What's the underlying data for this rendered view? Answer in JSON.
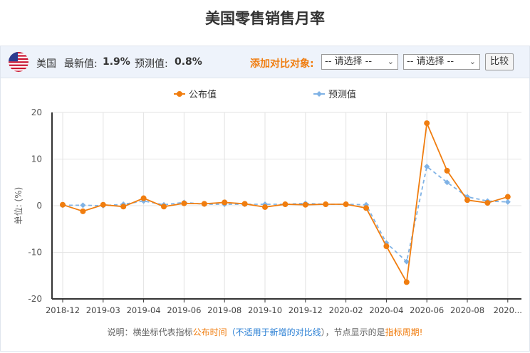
{
  "page": {
    "title": "美国零售销售月率"
  },
  "toolbar": {
    "country": "美国",
    "latest_label": "最新值:",
    "latest_value": "1.9%",
    "forecast_label": "预测值:",
    "forecast_value": "0.8%",
    "compare_label": "添加对比对象:",
    "select1": "-- 请选择 --",
    "select2": "-- 请选择 --",
    "compare_button": "比较"
  },
  "note": {
    "p1": "说明：横坐标代表指标",
    "p2": "公布时间",
    "p3": "（",
    "p4": "不适用于新增的对比线",
    "p5": "），节点显示的是",
    "p6": "指标周期!"
  },
  "colors": {
    "actual": "#f07d0f",
    "forecast": "#7fb2e5",
    "accent": "#f07d0f"
  },
  "chart_data": {
    "type": "line",
    "ylabel": "单位: (%)",
    "ylim": [
      -20,
      20
    ],
    "yticks": [
      20,
      10,
      0,
      -10,
      -20
    ],
    "xtick_labels": [
      "2018-12",
      "2019-03",
      "2019-04",
      "2019-06",
      "2019-08",
      "2019-10",
      "2019-12",
      "2020-02",
      "2020-04",
      "2020-06",
      "2020-08",
      "2020..."
    ],
    "legend": {
      "position": "top",
      "items": [
        "公布值",
        "预测值"
      ]
    },
    "series": [
      {
        "name": "公布值",
        "style": "solid",
        "values": [
          0.2,
          -1.2,
          0.2,
          -0.2,
          1.6,
          -0.2,
          0.5,
          0.4,
          0.7,
          0.4,
          -0.3,
          0.3,
          0.2,
          0.3,
          0.3,
          -0.5,
          -8.7,
          -16.4,
          17.7,
          7.5,
          1.2,
          0.6,
          1.9
        ]
      },
      {
        "name": "预测值",
        "style": "dashed",
        "values": [
          0.1,
          0.1,
          0.0,
          0.3,
          1.0,
          0.2,
          0.7,
          0.3,
          0.3,
          0.3,
          0.3,
          0.3,
          0.5,
          0.3,
          0.3,
          0.2,
          -8.0,
          -12.0,
          8.4,
          5.0,
          1.9,
          1.0,
          0.8
        ]
      }
    ]
  }
}
